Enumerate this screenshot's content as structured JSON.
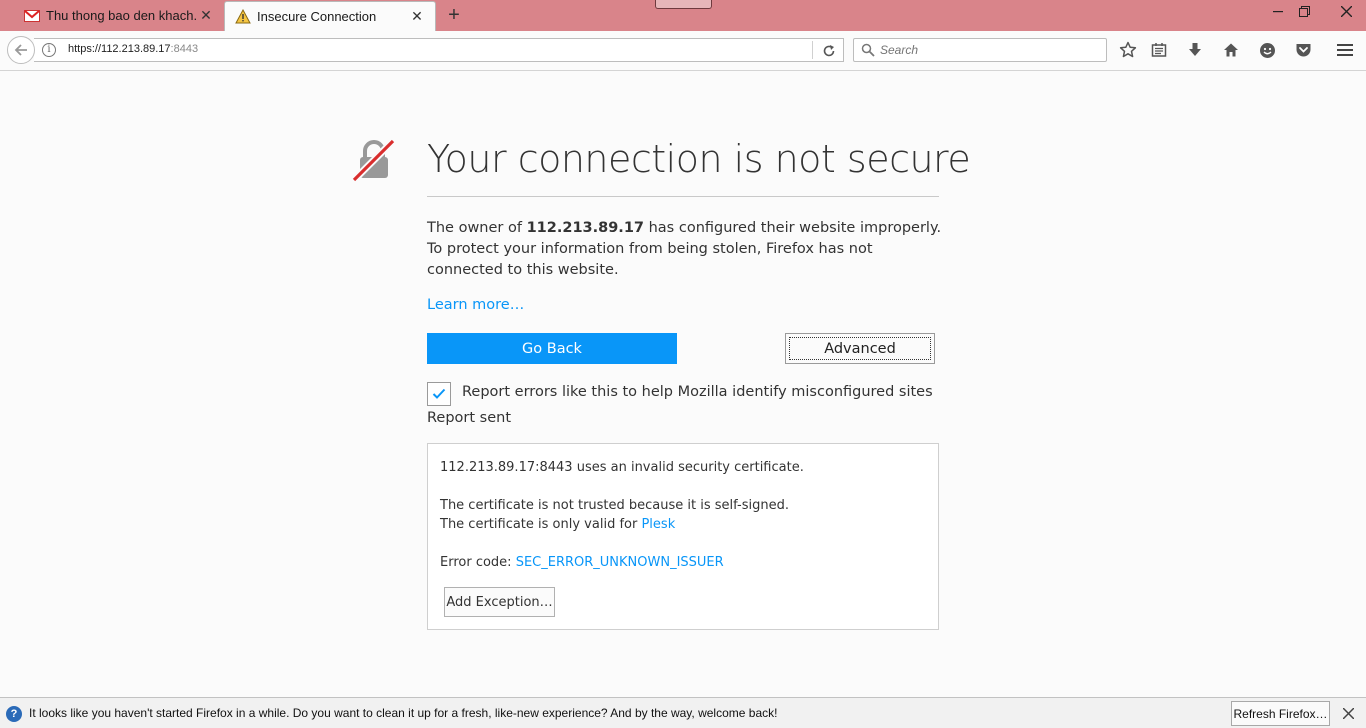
{
  "tabs": [
    {
      "label": "Thu thong bao den khach...",
      "icon": "gmail-icon"
    },
    {
      "label": "Insecure Connection",
      "icon": "warning-icon"
    }
  ],
  "urlbar": {
    "host": "https://112.213.89.17",
    "port": ":8443"
  },
  "search": {
    "placeholder": "Search"
  },
  "toolbar_icons": [
    "bookmark-star-icon",
    "reading-list-icon",
    "download-icon",
    "home-icon",
    "hello-chat-icon",
    "pocket-icon",
    "menu-icon"
  ],
  "error_page": {
    "title": "Your connection is not secure",
    "intro_prefix": "The owner of ",
    "intro_host": "112.213.89.17",
    "intro_suffix": " has configured their website improperly. To protect your information from being stolen, Firefox has not connected to this website.",
    "learn_more": "Learn more…",
    "go_back_label": "Go Back",
    "advanced_label": "Advanced",
    "report_label": "Report errors like this to help Mozilla identify misconfigured sites",
    "report_checked": true,
    "report_sent": "Report sent"
  },
  "details": {
    "invalid_cert": "112.213.89.17:8443 uses an invalid security certificate.",
    "not_trusted": "The certificate is not trusted because it is self-signed.",
    "valid_for_prefix": "The certificate is only valid for ",
    "valid_for_name": "Plesk",
    "error_code_prefix": "Error code: ",
    "error_code": "SEC_ERROR_UNKNOWN_ISSUER",
    "add_exception_label": "Add Exception…"
  },
  "notification": {
    "text": "It looks like you haven't started Firefox in a while. Do you want to clean it up for a fresh, like-new experience? And by the way, welcome back!",
    "button_label": "Refresh Firefox…"
  },
  "colors": {
    "titlebar": "#d9848a",
    "accent_blue": "#0996f8",
    "lock_red": "#d92d2d"
  }
}
